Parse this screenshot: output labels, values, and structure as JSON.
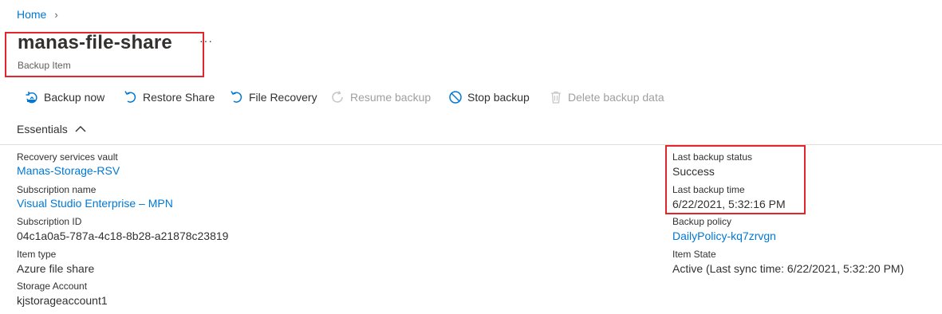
{
  "breadcrumb": {
    "home": "Home",
    "separator": "›"
  },
  "header": {
    "title": "manas-file-share",
    "subtitle": "Backup Item",
    "more": "···"
  },
  "toolbar": {
    "backup_now": "Backup now",
    "restore_share": "Restore Share",
    "file_recovery": "File Recovery",
    "resume_backup": "Resume backup",
    "stop_backup": "Stop backup",
    "delete_backup_data": "Delete backup data"
  },
  "essentials": {
    "label": "Essentials"
  },
  "left": {
    "vault_label": "Recovery services vault",
    "vault_value": "Manas-Storage-RSV",
    "subscription_name_label": "Subscription name",
    "subscription_name_value": "Visual Studio Enterprise – MPN",
    "subscription_id_label": "Subscription ID",
    "subscription_id_value": "04c1a0a5-787a-4c18-8b28-a21878c23819",
    "item_type_label": "Item type",
    "item_type_value": "Azure file share",
    "storage_account_label": "Storage Account",
    "storage_account_value": "kjstorageaccount1"
  },
  "right": {
    "last_backup_status_label": "Last backup status",
    "last_backup_status_value": "Success",
    "last_backup_time_label": "Last backup time",
    "last_backup_time_value": "6/22/2021, 5:32:16 PM",
    "backup_policy_label": "Backup policy",
    "backup_policy_value": "DailyPolicy-kq7zrvgn",
    "item_state_label": "Item State",
    "item_state_value": "Active (Last sync time: 6/22/2021, 5:32:20 PM)"
  },
  "colors": {
    "accent": "#0078d4",
    "highlight": "#e3262d",
    "disabled": "#a19f9d"
  }
}
